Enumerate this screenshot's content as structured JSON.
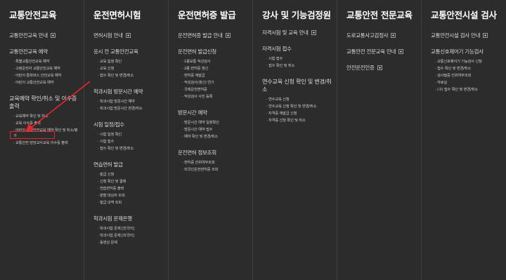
{
  "columns": [
    {
      "title": "교통안전교육",
      "sections": [
        {
          "head": "교통안전교육 안내",
          "plus": true,
          "items": []
        },
        {
          "head": "교통안전교육 예약",
          "items": [
            "· 특별교통안전교육 예약",
            "· 고령운전자 교통안전교육 예약",
            "· 어린이 통학버스 안전교육 예약",
            "· 어린이 교통안전교육 예약"
          ]
        },
        {
          "head": "교육예약 확인/취소 및 이수증 출력",
          "items": [
            "· 교육예약 확인 및 취소",
            "· 교육 이수증 출력",
            "· 어린이 교통안전교육 예약 확인 및 취소/평가",
            "· 교통안전 담당교사교육 이수증 출력"
          ]
        }
      ]
    },
    {
      "title": "운전면허시험",
      "sections": [
        {
          "head": "면허시험 안내",
          "plus": true,
          "items": []
        },
        {
          "head": "응시 전 교통안전교육",
          "items": [
            "· 교육 일정 확인",
            "· 교육 신청",
            "· 접수 확인 및 변경/취소"
          ]
        },
        {
          "head": "학과시험 방문시간 예약",
          "items": [
            "· 학과시험 방문시간 예약",
            "· 학과시험 방문시간 변경/취소"
          ]
        },
        {
          "head": "시험 일정/접수",
          "items": [
            "· 시험 일정 확인",
            "· 시험 접수",
            "· 접수 확인 및 변경/취소"
          ]
        },
        {
          "head": "연습면허 발급",
          "items": [
            "· 발급 신청",
            "· 신청 확인 및 결제",
            "· 연습면허증 출력",
            "· 분할 대상자 조회",
            "· 발급 내역 조회"
          ]
        },
        {
          "head": "학과시험 문제은행",
          "items": [
            "· 학과시험 문제 [한국어]",
            "· 학과시험 문제 [외국어]",
            "· 동영상 문제"
          ]
        }
      ]
    },
    {
      "title": "운전면허증 발급",
      "sections": [
        {
          "head": "운전면허증 발급 안내",
          "plus": true,
          "items": []
        },
        {
          "head": "운전면허 발급신청",
          "items": [
            "· 1종보통 적성검사",
            "· 2종 면허증 갱신",
            "· 면허증 재발급",
            "· 적성검사(갱신) 연기",
            "· 국제운전면허증",
            "· 적성검사 사진 등록"
          ]
        },
        {
          "head": "방문시간 예약",
          "items": [
            "· 방문시간 예약 일정확인",
            "· 방문시간 예약 접수",
            "· 예약 확인 및 변경/취소"
          ]
        },
        {
          "head": "운전면허 정보조회",
          "items": [
            "· 면허증 진위여부조회",
            "· 외국인운전면허증 조회"
          ]
        }
      ]
    },
    {
      "title": "강사 및 기능검정원",
      "sections": [
        {
          "head": "자격시험 및 교육 안내",
          "plus": true,
          "items": []
        },
        {
          "head": "자격시험 접수",
          "items": [
            "· 시험 접수",
            "· 접수 확인 및 취소"
          ]
        },
        {
          "head": "연수교육 신청 확인 및 변경/취소",
          "items": [
            "· 연수교육 신청",
            "· 연수교육 신청 확인 및 변경/취소",
            "· 자격증 재발급 신청",
            "· 자격증 신청 확인 및 취소"
          ]
        }
      ]
    },
    {
      "title": "교통안전 전문교육",
      "sections": [
        {
          "head": "도로교통사고감정사",
          "plus": true,
          "items": []
        },
        {
          "head": "교통안전 전문교육 안내",
          "plus": true,
          "items": []
        },
        {
          "head": "안전운전인증",
          "plus": true,
          "items": []
        }
      ]
    },
    {
      "title": "교통안전시설 검사",
      "sections": [
        {
          "head": "교통안전시설 검사 안내",
          "plus": true,
          "items": []
        },
        {
          "head": "교통신호제어기 기능검사",
          "items": [
            "· 교통신호제어기 기능검사 신청",
            "· 접수 확인 및 변경/취소",
            "· 검사필증 진위여부조회",
            "· 자료실",
            "· (구) 접수 확인 및 변경/취소"
          ]
        }
      ]
    }
  ],
  "colors": {
    "background": "#2c2c2c",
    "highlight": "#e8262a"
  }
}
